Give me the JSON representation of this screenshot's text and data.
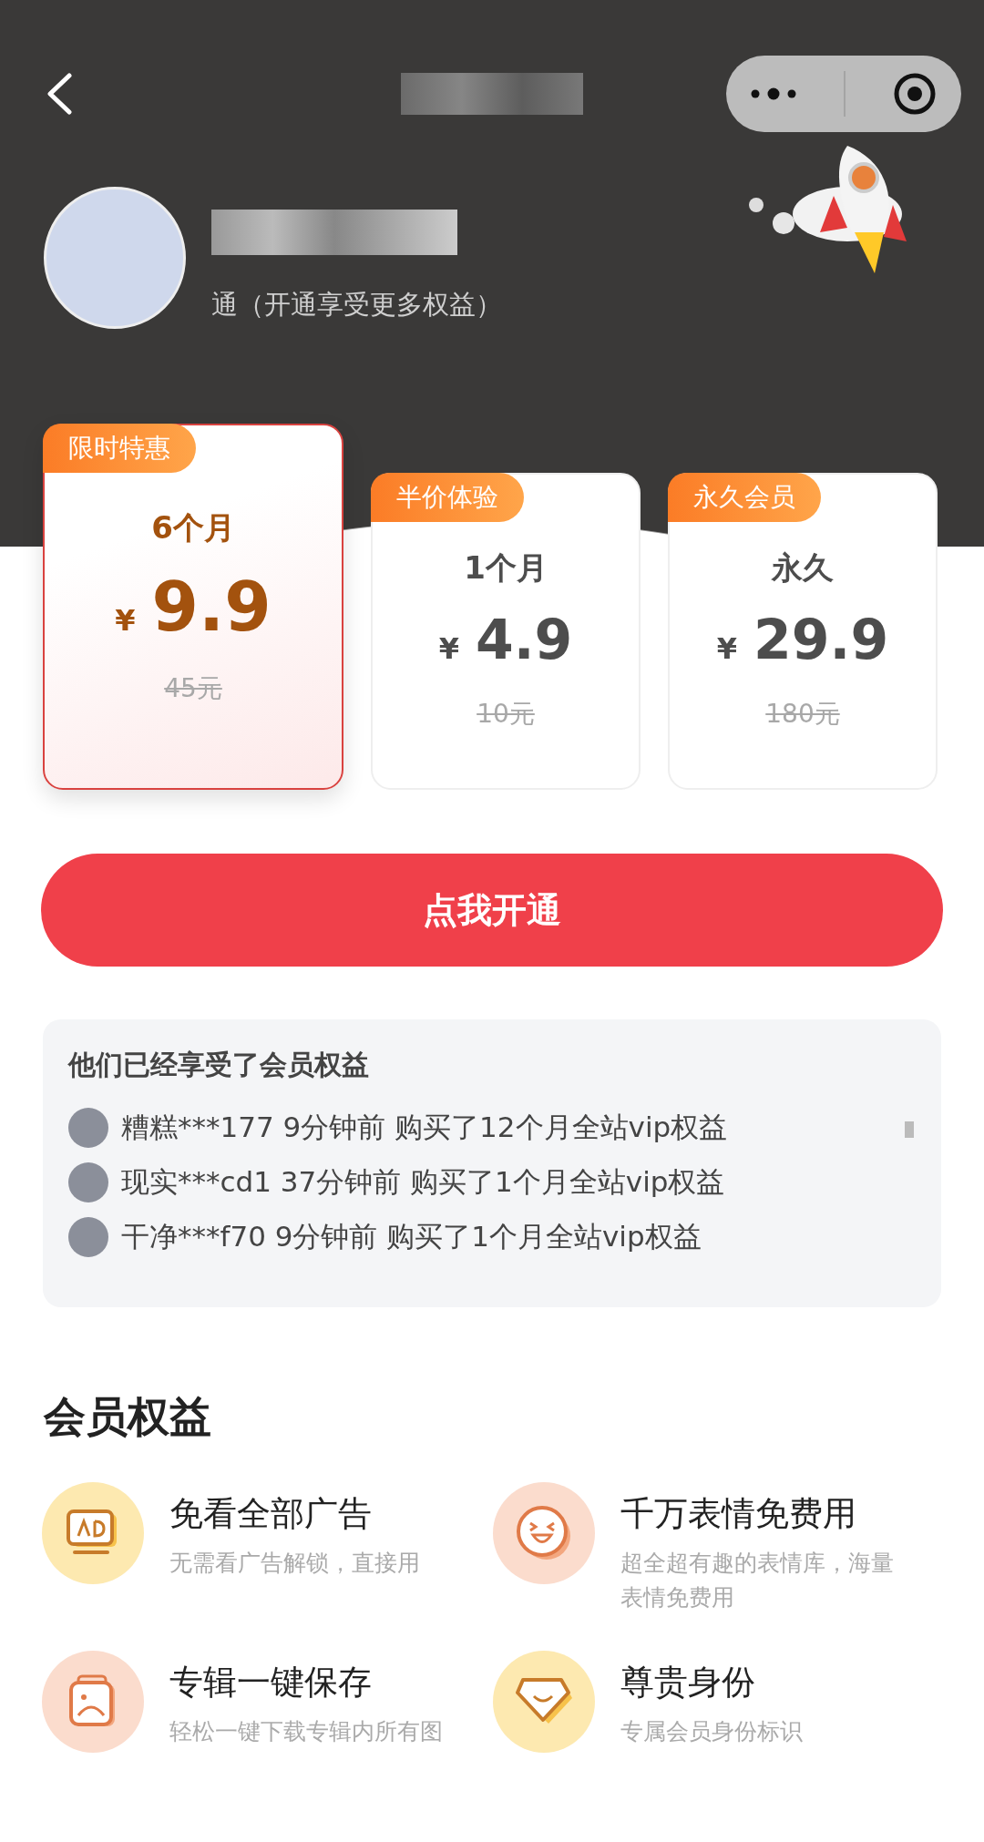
{
  "profile": {
    "status": "通（开通享受更多权益）"
  },
  "plans": [
    {
      "badge": "限时特惠",
      "duration": "6个月",
      "currency": "¥",
      "price": "9.9",
      "original_price": "45元",
      "selected": true
    },
    {
      "badge": "半价体验",
      "duration": "1个月",
      "currency": "¥",
      "price": "4.9",
      "original_price": "10元",
      "selected": false
    },
    {
      "badge": "永久会员",
      "duration": "永久",
      "currency": "¥",
      "price": "29.9",
      "original_price": "180元",
      "selected": false
    }
  ],
  "cta": "点我开通",
  "recent": {
    "title": "他们已经享受了会员权益",
    "items": [
      {
        "text": "糟糕***177 9分钟前 购买了12个月全站vip权益"
      },
      {
        "text": "现实***cd1 37分钟前 购买了1个月全站vip权益"
      },
      {
        "text": "干净***f70 9分钟前 购买了1个月全站vip权益"
      }
    ]
  },
  "benefits": {
    "title": "会员权益",
    "items": [
      {
        "kind": "ad",
        "title": "免看全部广告",
        "desc": "无需看广告解锁，直接用"
      },
      {
        "kind": "emoji",
        "title": "千万表情免费用",
        "desc": "超全超有趣的表情库，海量表情免费用"
      },
      {
        "kind": "album",
        "title": "专辑一键保存",
        "desc": "轻松一键下载专辑内所有图"
      },
      {
        "kind": "diamond",
        "title": "尊贵身份",
        "desc": "专属会员身份标识"
      }
    ]
  }
}
